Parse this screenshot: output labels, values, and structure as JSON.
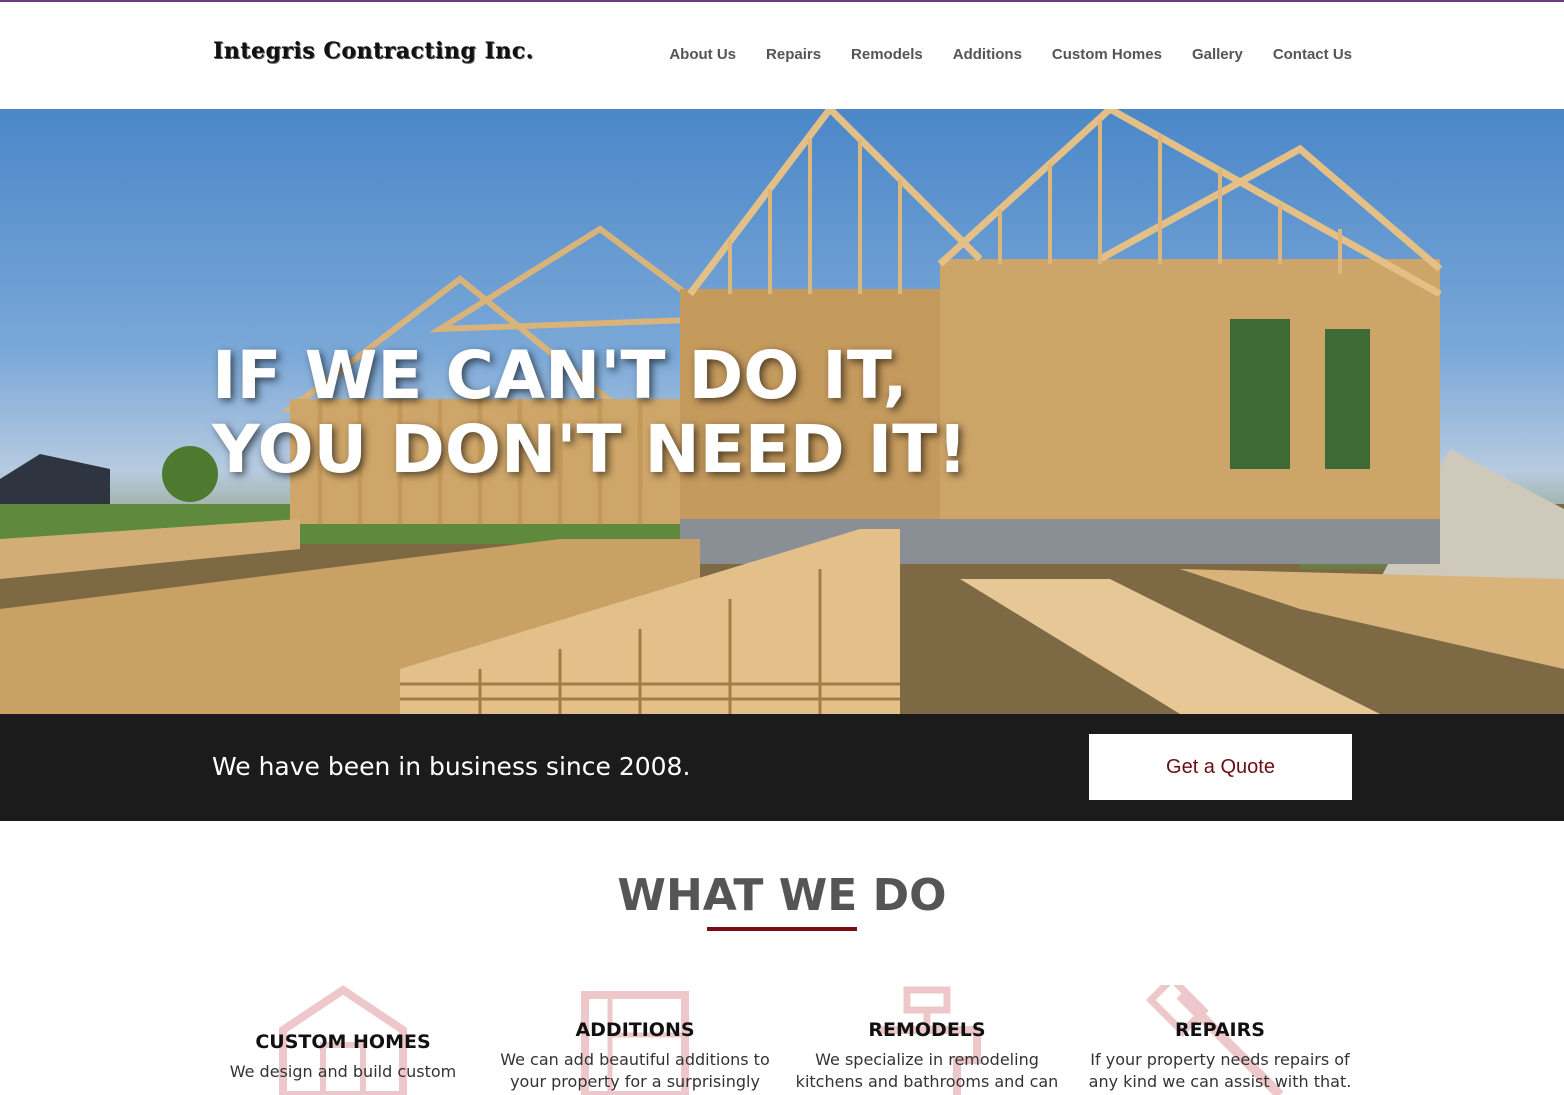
{
  "brand": {
    "logo_text": "Integris Contracting Inc.",
    "accent_color": "#7a0d12"
  },
  "nav": {
    "items": [
      {
        "label": "About Us"
      },
      {
        "label": "Repairs"
      },
      {
        "label": "Remodels"
      },
      {
        "label": "Additions"
      },
      {
        "label": "Custom Homes"
      },
      {
        "label": "Gallery"
      },
      {
        "label": "Contact Us"
      }
    ]
  },
  "hero": {
    "line1": "IF WE CAN'T DO IT,",
    "line2": "YOU DON'T NEED IT!"
  },
  "band": {
    "tagline": "We have been in business since 2008.",
    "cta_label": "Get a Quote"
  },
  "section": {
    "title": "WHAT WE DO"
  },
  "services": [
    {
      "title": "CUSTOM HOMES",
      "text": "We design and build custom",
      "icon": "house-icon"
    },
    {
      "title": "ADDITIONS",
      "text": "We can add beautiful additions to your property for a surprisingly",
      "icon": "blueprint-icon"
    },
    {
      "title": "REMODELS",
      "text": "We specialize in remodeling kitchens and bathrooms and can",
      "icon": "faucet-icon"
    },
    {
      "title": "REPAIRS",
      "text": "If your property needs repairs of any kind we can assist with that.",
      "icon": "hammer-icon"
    }
  ]
}
